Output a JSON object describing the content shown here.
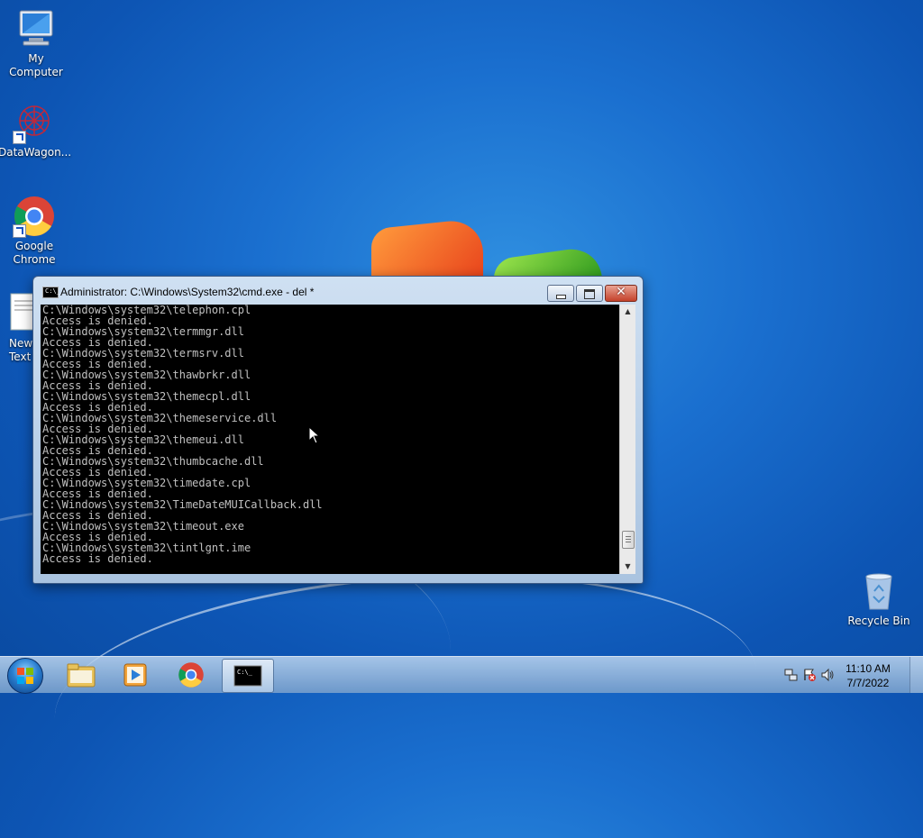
{
  "desktop": {
    "icons": [
      {
        "label": "My Computer"
      },
      {
        "label": "DataWagon..."
      },
      {
        "label": "Google Chrome"
      },
      {
        "label": "New Text"
      },
      {
        "label": "Recycle Bin"
      }
    ]
  },
  "window": {
    "title": "Administrator: C:\\Windows\\System32\\cmd.exe - del  *",
    "icon_label": "C:\\_",
    "lines": [
      "C:\\Windows\\system32\\telephon.cpl",
      "Access is denied.",
      "C:\\Windows\\system32\\termmgr.dll",
      "Access is denied.",
      "C:\\Windows\\system32\\termsrv.dll",
      "Access is denied.",
      "C:\\Windows\\system32\\thawbrkr.dll",
      "Access is denied.",
      "C:\\Windows\\system32\\themecpl.dll",
      "Access is denied.",
      "C:\\Windows\\system32\\themeservice.dll",
      "Access is denied.",
      "C:\\Windows\\system32\\themeui.dll",
      "Access is denied.",
      "C:\\Windows\\system32\\thumbcache.dll",
      "Access is denied.",
      "C:\\Windows\\system32\\timedate.cpl",
      "Access is denied.",
      "C:\\Windows\\system32\\TimeDateMUICallback.dll",
      "Access is denied.",
      "C:\\Windows\\system32\\timeout.exe",
      "Access is denied.",
      "C:\\Windows\\system32\\tintlgnt.ime",
      "Access is denied."
    ],
    "scroll_position": 0.95
  },
  "taskbar": {
    "clock_time": "11:10 AM",
    "clock_date": "7/7/2022"
  },
  "colors": {
    "desktop_bg": "#1a6fcf",
    "console_bg": "#000000",
    "console_fg": "#c0c0c0"
  }
}
